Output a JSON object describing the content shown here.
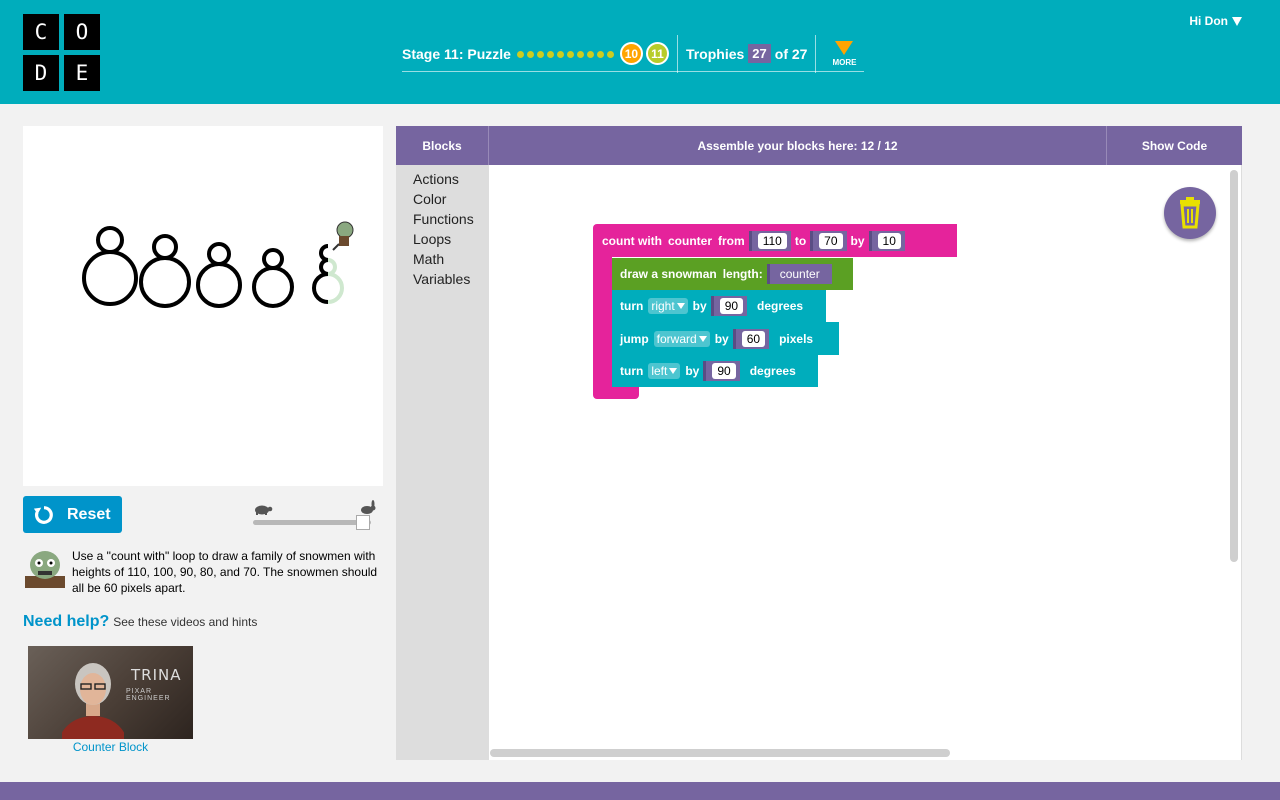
{
  "header": {
    "logo_letters": [
      "C",
      "O",
      "D",
      "E"
    ],
    "stage_label": "Stage 11: Puzzle",
    "completed_dots": 10,
    "current_puzzle": "10",
    "next_puzzle": "11",
    "trophies_label": "Trophies",
    "trophies_count": "27",
    "trophies_total": "of 27",
    "more_label": "MORE",
    "user_greeting": "Hi Don"
  },
  "controls": {
    "reset_label": "Reset"
  },
  "instructions": {
    "text": "Use a \"count with\" loop to draw a family of snowmen with heights of 110, 100, 90, 80, and 70. The snowmen should all be 60 pixels apart."
  },
  "help": {
    "title": "Need help?",
    "subtitle": "See these videos and hints",
    "video_name": "TRINA",
    "video_role": "PIXAR ENGINEER",
    "video_caption": "Counter Block"
  },
  "workspace": {
    "blocks_tab": "Blocks",
    "assemble_label": "Assemble your blocks here: 12 / 12",
    "show_code": "Show Code"
  },
  "toolbox": [
    "Actions",
    "Color",
    "Functions",
    "Loops",
    "Math",
    "Variables"
  ],
  "blocks": {
    "count_with": "count with",
    "counter": "counter",
    "from": "from",
    "from_value": "110",
    "to": "to",
    "to_value": "70",
    "by": "by",
    "by_value": "10",
    "draw_snowman": "draw a snowman",
    "length": "length:",
    "length_var": "counter",
    "turn": "turn",
    "turn1_dir": "right",
    "turn1_value": "90",
    "degrees": "degrees",
    "jump": "jump",
    "jump_dir": "forward",
    "jump_value": "60",
    "pixels": "pixels",
    "turn2_dir": "left",
    "turn2_value": "90"
  },
  "colors": {
    "header_bg": "#00adbc",
    "purple": "#7665a0",
    "loop_pink": "#e5239b",
    "function_green": "#5ba023",
    "action_teal": "#00adbc",
    "orange": "#ffa400"
  }
}
